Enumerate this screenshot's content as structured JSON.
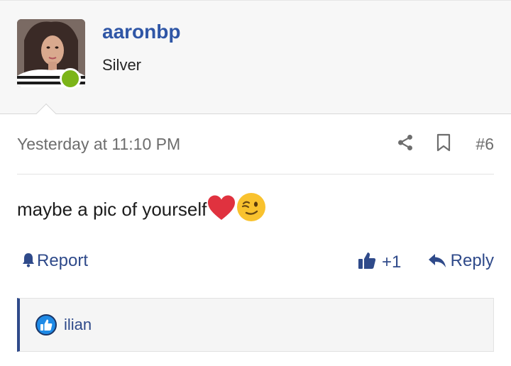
{
  "author": {
    "username": "aaronbp",
    "rank": "Silver",
    "online": true
  },
  "post": {
    "timestamp": "Yesterday at 11:10 PM",
    "number": "#6",
    "message": "maybe a pic of yourself",
    "emojis": [
      "red-heart",
      "winking-face"
    ]
  },
  "actions": {
    "report_label": "Report",
    "like_count": "+1",
    "reply_label": "Reply"
  },
  "reactions": {
    "type": "like",
    "users": [
      "ilian"
    ]
  },
  "colors": {
    "username": "#2f56a6",
    "link": "#2f4a8a",
    "online": "#7cb518",
    "header_bg": "#f7f7f7"
  }
}
